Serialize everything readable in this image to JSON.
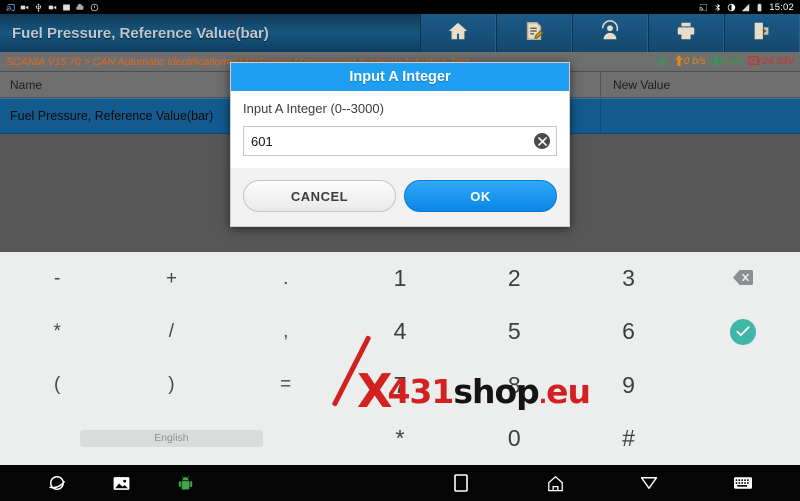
{
  "status_bar": {
    "icons": [
      "cast-icon",
      "bluetooth-icon",
      "usb-icon",
      "signal-icon",
      "battery-icon"
    ],
    "time": "15:02"
  },
  "header": {
    "title": "Fuel Pressure, Reference Value(bar)",
    "toolbar": [
      {
        "name": "home-icon",
        "label": "Home"
      },
      {
        "name": "report-icon",
        "label": "Report"
      },
      {
        "name": "support-icon",
        "label": "Support"
      },
      {
        "name": "print-icon",
        "label": "Print"
      },
      {
        "name": "exit-icon",
        "label": "Exit"
      }
    ]
  },
  "info_bar": {
    "breadcrumb": "SCANIA V15.70 > CAN Automatic Identification>EMS(Engine Management System)>Actuation Test",
    "wifi_icon": "wifi-icon",
    "upload_rate": "0 b/s",
    "download_rate": "0 b/s",
    "voltage": "24.93V"
  },
  "table": {
    "columns": [
      "Name",
      "New Value"
    ],
    "rows": [
      {
        "name": "Fuel Pressure, Reference Value(bar)",
        "new_value": ""
      }
    ]
  },
  "dialog": {
    "title": "Input A Integer",
    "label": "Input A Integer (0--3000)",
    "input_value": "601",
    "input_placeholder": "",
    "clear_icon": "clear-circle-icon",
    "cancel_label": "CANCEL",
    "ok_label": "OK"
  },
  "keyboard": {
    "rows": [
      [
        "-",
        "+",
        ".",
        "1",
        "2",
        "3"
      ],
      [
        "*",
        "/",
        ",",
        "4",
        "5",
        "6"
      ],
      [
        "(",
        ")",
        "=",
        "7",
        "8",
        "9"
      ],
      [
        "*",
        "0",
        "#"
      ]
    ],
    "space_label": "English",
    "backspace_icon": "backspace-icon",
    "enter_icon": "check-icon"
  },
  "watermark": {
    "x": "X",
    "num": "431",
    "shop": "shop",
    "dot": ".",
    "tld": "eu"
  },
  "nav_bar": {
    "left": [
      "planet-icon",
      "gallery-icon",
      "android-robot-icon"
    ],
    "right": [
      "recents-icon",
      "home-icon",
      "back-icon",
      "keyboard-icon"
    ]
  },
  "colors": {
    "accent_blue": "#1e9ff2",
    "row_highlight": "#135a8e",
    "breadcrumb_orange": "#e06a1a",
    "voltage_red": "#cf3030",
    "download_green": "#2f9e4f",
    "enter_teal": "#3fb6a8",
    "watermark_red": "#d32020"
  }
}
